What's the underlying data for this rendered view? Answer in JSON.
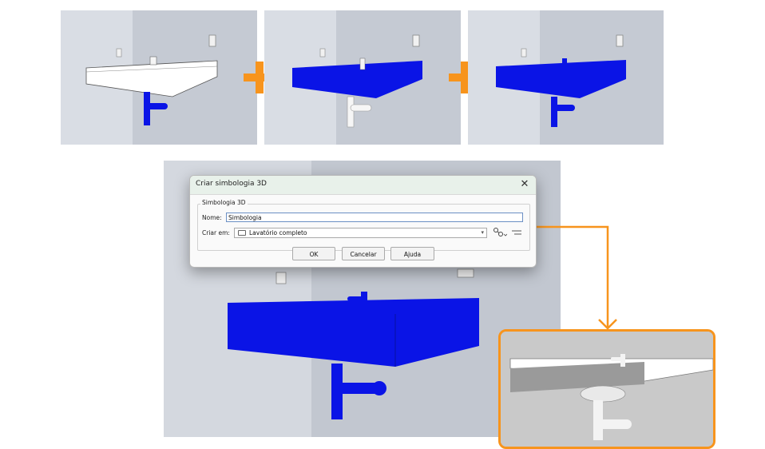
{
  "dialog": {
    "title": "Criar simbologia 3D",
    "close_glyph": "✕",
    "group_label": "Simbologia 3D",
    "name_label": "Nome:",
    "name_value": "Simbologia",
    "create_in_label": "Criar em:",
    "create_in_value": "Lavatório completo",
    "dropdown_glyph": "▾",
    "ok_label": "OK",
    "cancel_label": "Cancelar",
    "help_label": "Ajuda"
  },
  "icons": {
    "plus": "plus-icon",
    "folder": "folder-icon",
    "pick": "pick-element-icon",
    "pencil": "edit-icon",
    "close": "close-icon"
  },
  "colors": {
    "accent": "#f7941d",
    "highlight_blue": "#0a14e6",
    "wall_light": "#d9dde4",
    "wall_dark": "#c4c9d2"
  }
}
